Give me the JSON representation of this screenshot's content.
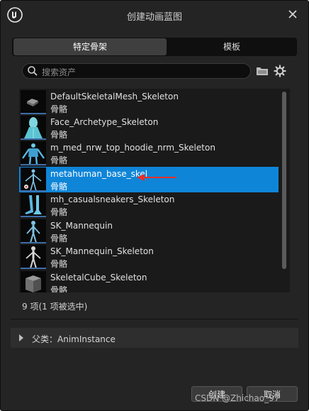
{
  "dialog": {
    "title": "创建动画蓝图",
    "tabs": [
      {
        "label": "特定骨架",
        "active": true
      },
      {
        "label": "模板",
        "active": false
      }
    ],
    "search": {
      "placeholder": "搜索资产"
    },
    "assets": [
      {
        "name": "DefaultSkeletalMesh_Skeleton",
        "type": "骨骼",
        "selected": false
      },
      {
        "name": "Face_Archetype_Skeleton",
        "type": "骨骼",
        "selected": false
      },
      {
        "name": "m_med_nrw_top_hoodie_nrm_Skeleton",
        "type": "骨骼",
        "selected": false
      },
      {
        "name": "metahuman_base_skel",
        "type": "骨骼",
        "selected": true
      },
      {
        "name": "mh_casualsneakers_Skeleton",
        "type": "骨骼",
        "selected": false
      },
      {
        "name": "SK_Mannequin",
        "type": "骨骼",
        "selected": false
      },
      {
        "name": "SK_Mannequin_Skeleton",
        "type": "骨骼",
        "selected": false
      },
      {
        "name": "SkeletalCube_Skeleton",
        "type": "骨骼",
        "selected": false
      }
    ],
    "item_count": "9 项(1 项被选中)",
    "parent_class": "父类：AnimInstance",
    "buttons": {
      "create": "创建",
      "cancel": "取消"
    }
  },
  "watermark": "CSDN @Zhichao_97",
  "colors": {
    "background": "#242424",
    "selection": "#0f85d8",
    "annotation_arrow": "#e8302a"
  }
}
